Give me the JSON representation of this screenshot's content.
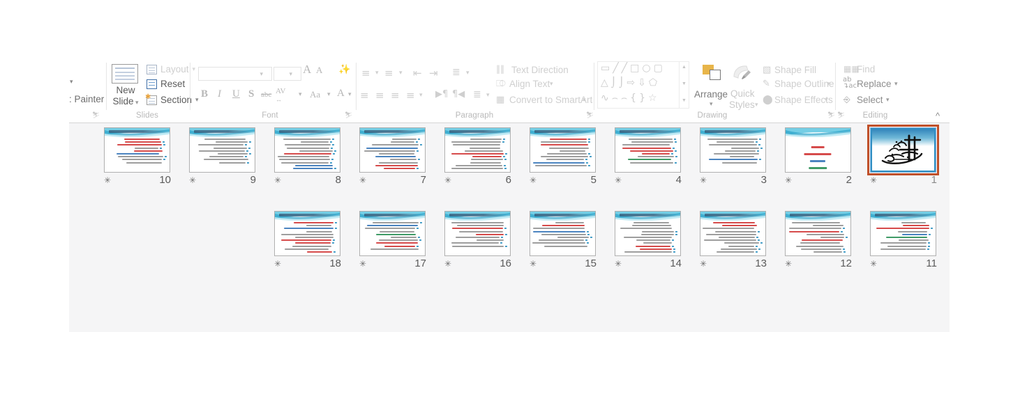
{
  "ribbon": {
    "collapse_icon": "chevron-up-icon",
    "clipboard": {
      "format_painter_label": ": Painter",
      "caret_icon": "chevron-down-icon",
      "dialog_launcher": "dialog-launcher-icon"
    },
    "groups": [
      {
        "id": "slides",
        "label": "Slides"
      },
      {
        "id": "font",
        "label": "Font"
      },
      {
        "id": "paragraph",
        "label": "Paragraph"
      },
      {
        "id": "drawing",
        "label": "Drawing"
      },
      {
        "id": "editing",
        "label": "Editing"
      }
    ],
    "slides_group": {
      "new_slide_line1": "New",
      "new_slide_line2": "Slide",
      "layout_label": "Layout",
      "reset_label": "Reset",
      "section_label": "Section",
      "dropdown_caret": "▾"
    },
    "font_group": {
      "font_name_value": "",
      "font_size_value": "",
      "grow_font": "A",
      "shrink_font": "A",
      "clear_formatting": "clear-formatting-icon",
      "bold": "B",
      "italic": "I",
      "underline": "U",
      "shadow": "S",
      "strikethrough": "abc",
      "character_spacing": "AV",
      "change_case": "Aa",
      "font_color": "A"
    },
    "paragraph_group": {
      "text_direction_label": "Text Direction",
      "align_text_label": "Align Text",
      "convert_smartart_label": "Convert to SmartArt",
      "bullets_icon": "bullets-icon",
      "numbering_icon": "numbering-icon",
      "decrease_indent_icon": "decrease-indent-icon",
      "increase_indent_icon": "increase-indent-icon",
      "line_spacing_icon": "line-spacing-icon",
      "align_left_icon": "align-left-icon",
      "align_center_icon": "align-center-icon",
      "align_right_icon": "align-right-icon",
      "justify_icon": "justify-icon",
      "ltr_icon": "left-to-right-icon",
      "rtl_icon": "right-to-left-icon",
      "columns_icon": "columns-icon"
    },
    "drawing_group": {
      "arrange_label": "Arrange",
      "quick_styles_line1": "Quick",
      "quick_styles_line2": "Styles",
      "shape_fill_label": "Shape Fill",
      "shape_outline_label": "Shape Outline",
      "shape_effects_label": "Shape Effects",
      "shapes_rows": [
        [
          "▭",
          "╲",
          "╲",
          "□",
          "○",
          "□"
        ],
        [
          "△",
          "⌐",
          "⌐",
          "⇨",
          "⇩",
          "⌐"
        ],
        [
          "∿",
          "⌢",
          "⌢",
          "{",
          "}",
          "☆"
        ]
      ]
    },
    "editing_group": {
      "find_label": "Find",
      "replace_label": "Replace",
      "select_label": "Select",
      "replace_icon": "replace-abc-icon",
      "select_icon": "pointer-icon"
    }
  },
  "sorter": {
    "background_color": "#f5f5f6",
    "selected_slide_number": "1",
    "selection_border_color": "#c0502a",
    "accent_color": "#49a0c9",
    "animation_star_icon": "animation-star-icon",
    "slides": [
      {
        "number": "10",
        "row": 1,
        "col": 0,
        "type": "content",
        "has_animation": true
      },
      {
        "number": "9",
        "row": 1,
        "col": 1,
        "type": "content",
        "has_animation": true
      },
      {
        "number": "8",
        "row": 1,
        "col": 2,
        "type": "content",
        "has_animation": true
      },
      {
        "number": "7",
        "row": 1,
        "col": 3,
        "type": "content",
        "has_animation": true
      },
      {
        "number": "6",
        "row": 1,
        "col": 4,
        "type": "content",
        "has_animation": true
      },
      {
        "number": "5",
        "row": 1,
        "col": 5,
        "type": "content",
        "has_animation": true
      },
      {
        "number": "4",
        "row": 1,
        "col": 6,
        "type": "content",
        "has_animation": true
      },
      {
        "number": "3",
        "row": 1,
        "col": 7,
        "type": "content",
        "has_animation": true
      },
      {
        "number": "2",
        "row": 1,
        "col": 8,
        "type": "title",
        "has_animation": true
      },
      {
        "number": "1",
        "row": 1,
        "col": 9,
        "type": "calligraphy",
        "has_animation": true,
        "selected": true
      },
      {
        "number": "18",
        "row": 2,
        "col": 2,
        "type": "content",
        "has_animation": true
      },
      {
        "number": "17",
        "row": 2,
        "col": 3,
        "type": "content",
        "has_animation": true
      },
      {
        "number": "16",
        "row": 2,
        "col": 4,
        "type": "content",
        "has_animation": true
      },
      {
        "number": "15",
        "row": 2,
        "col": 5,
        "type": "content",
        "has_animation": true
      },
      {
        "number": "14",
        "row": 2,
        "col": 6,
        "type": "content",
        "has_animation": true
      },
      {
        "number": "13",
        "row": 2,
        "col": 7,
        "type": "content",
        "has_animation": true
      },
      {
        "number": "12",
        "row": 2,
        "col": 8,
        "type": "content",
        "has_animation": true
      },
      {
        "number": "11",
        "row": 2,
        "col": 9,
        "type": "content",
        "has_animation": true
      }
    ]
  }
}
